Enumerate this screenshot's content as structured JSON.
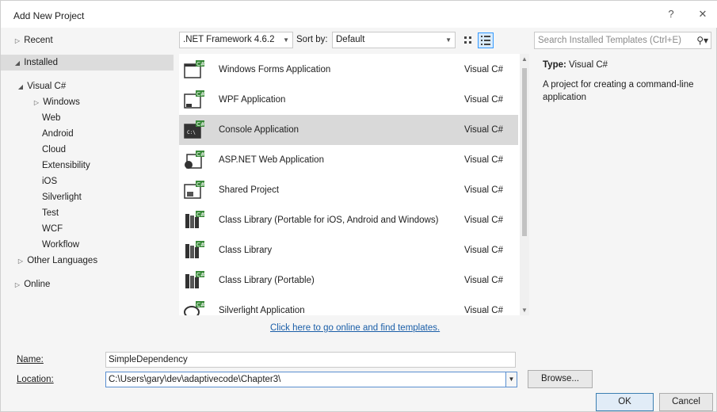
{
  "window": {
    "title": "Add New Project",
    "help_label": "?",
    "close_label": "✕"
  },
  "tree": {
    "recent": "Recent",
    "installed": "Installed",
    "visual_csharp": "Visual C#",
    "children": [
      "Windows",
      "Web",
      "Android",
      "Cloud",
      "Extensibility",
      "iOS",
      "Silverlight",
      "Test",
      "WCF",
      "Workflow"
    ],
    "other_languages": "Other Languages",
    "online": "Online"
  },
  "toolbar": {
    "framework": ".NET Framework 4.6.2",
    "sort_label": "Sort by:",
    "sort_value": "Default",
    "search_placeholder": "Search Installed Templates (Ctrl+E)"
  },
  "templates": [
    {
      "name": "Windows Forms Application",
      "lang": "Visual C#",
      "icon": "window-form-icon"
    },
    {
      "name": "WPF Application",
      "lang": "Visual C#",
      "icon": "wpf-window-icon"
    },
    {
      "name": "Console Application",
      "lang": "Visual C#",
      "icon": "console-icon"
    },
    {
      "name": "ASP.NET Web Application",
      "lang": "Visual C#",
      "icon": "web-globe-icon"
    },
    {
      "name": "Shared Project",
      "lang": "Visual C#",
      "icon": "shared-project-icon"
    },
    {
      "name": "Class Library (Portable for iOS, Android and Windows)",
      "lang": "Visual C#",
      "icon": "class-library-icon"
    },
    {
      "name": "Class Library",
      "lang": "Visual C#",
      "icon": "class-library-icon"
    },
    {
      "name": "Class Library (Portable)",
      "lang": "Visual C#",
      "icon": "class-library-icon"
    },
    {
      "name": "Silverlight Application",
      "lang": "Visual C#",
      "icon": "silverlight-icon"
    }
  ],
  "online_link": "Click here to go online and find templates.",
  "info": {
    "type_label": "Type:",
    "type_value": "Visual C#",
    "description": "A project for creating a command-line application"
  },
  "form": {
    "name_label": "Name:",
    "name_value": "SimpleDependency",
    "location_label": "Location:",
    "location_value": "C:\\Users\\gary\\dev\\adaptivecode\\Chapter3\\",
    "browse_label": "Browse...",
    "ok_label": "OK",
    "cancel_label": "Cancel"
  },
  "colors": {
    "accent": "#3399ff",
    "link": "#1a5ea8",
    "selection": "#d9d9d9"
  }
}
